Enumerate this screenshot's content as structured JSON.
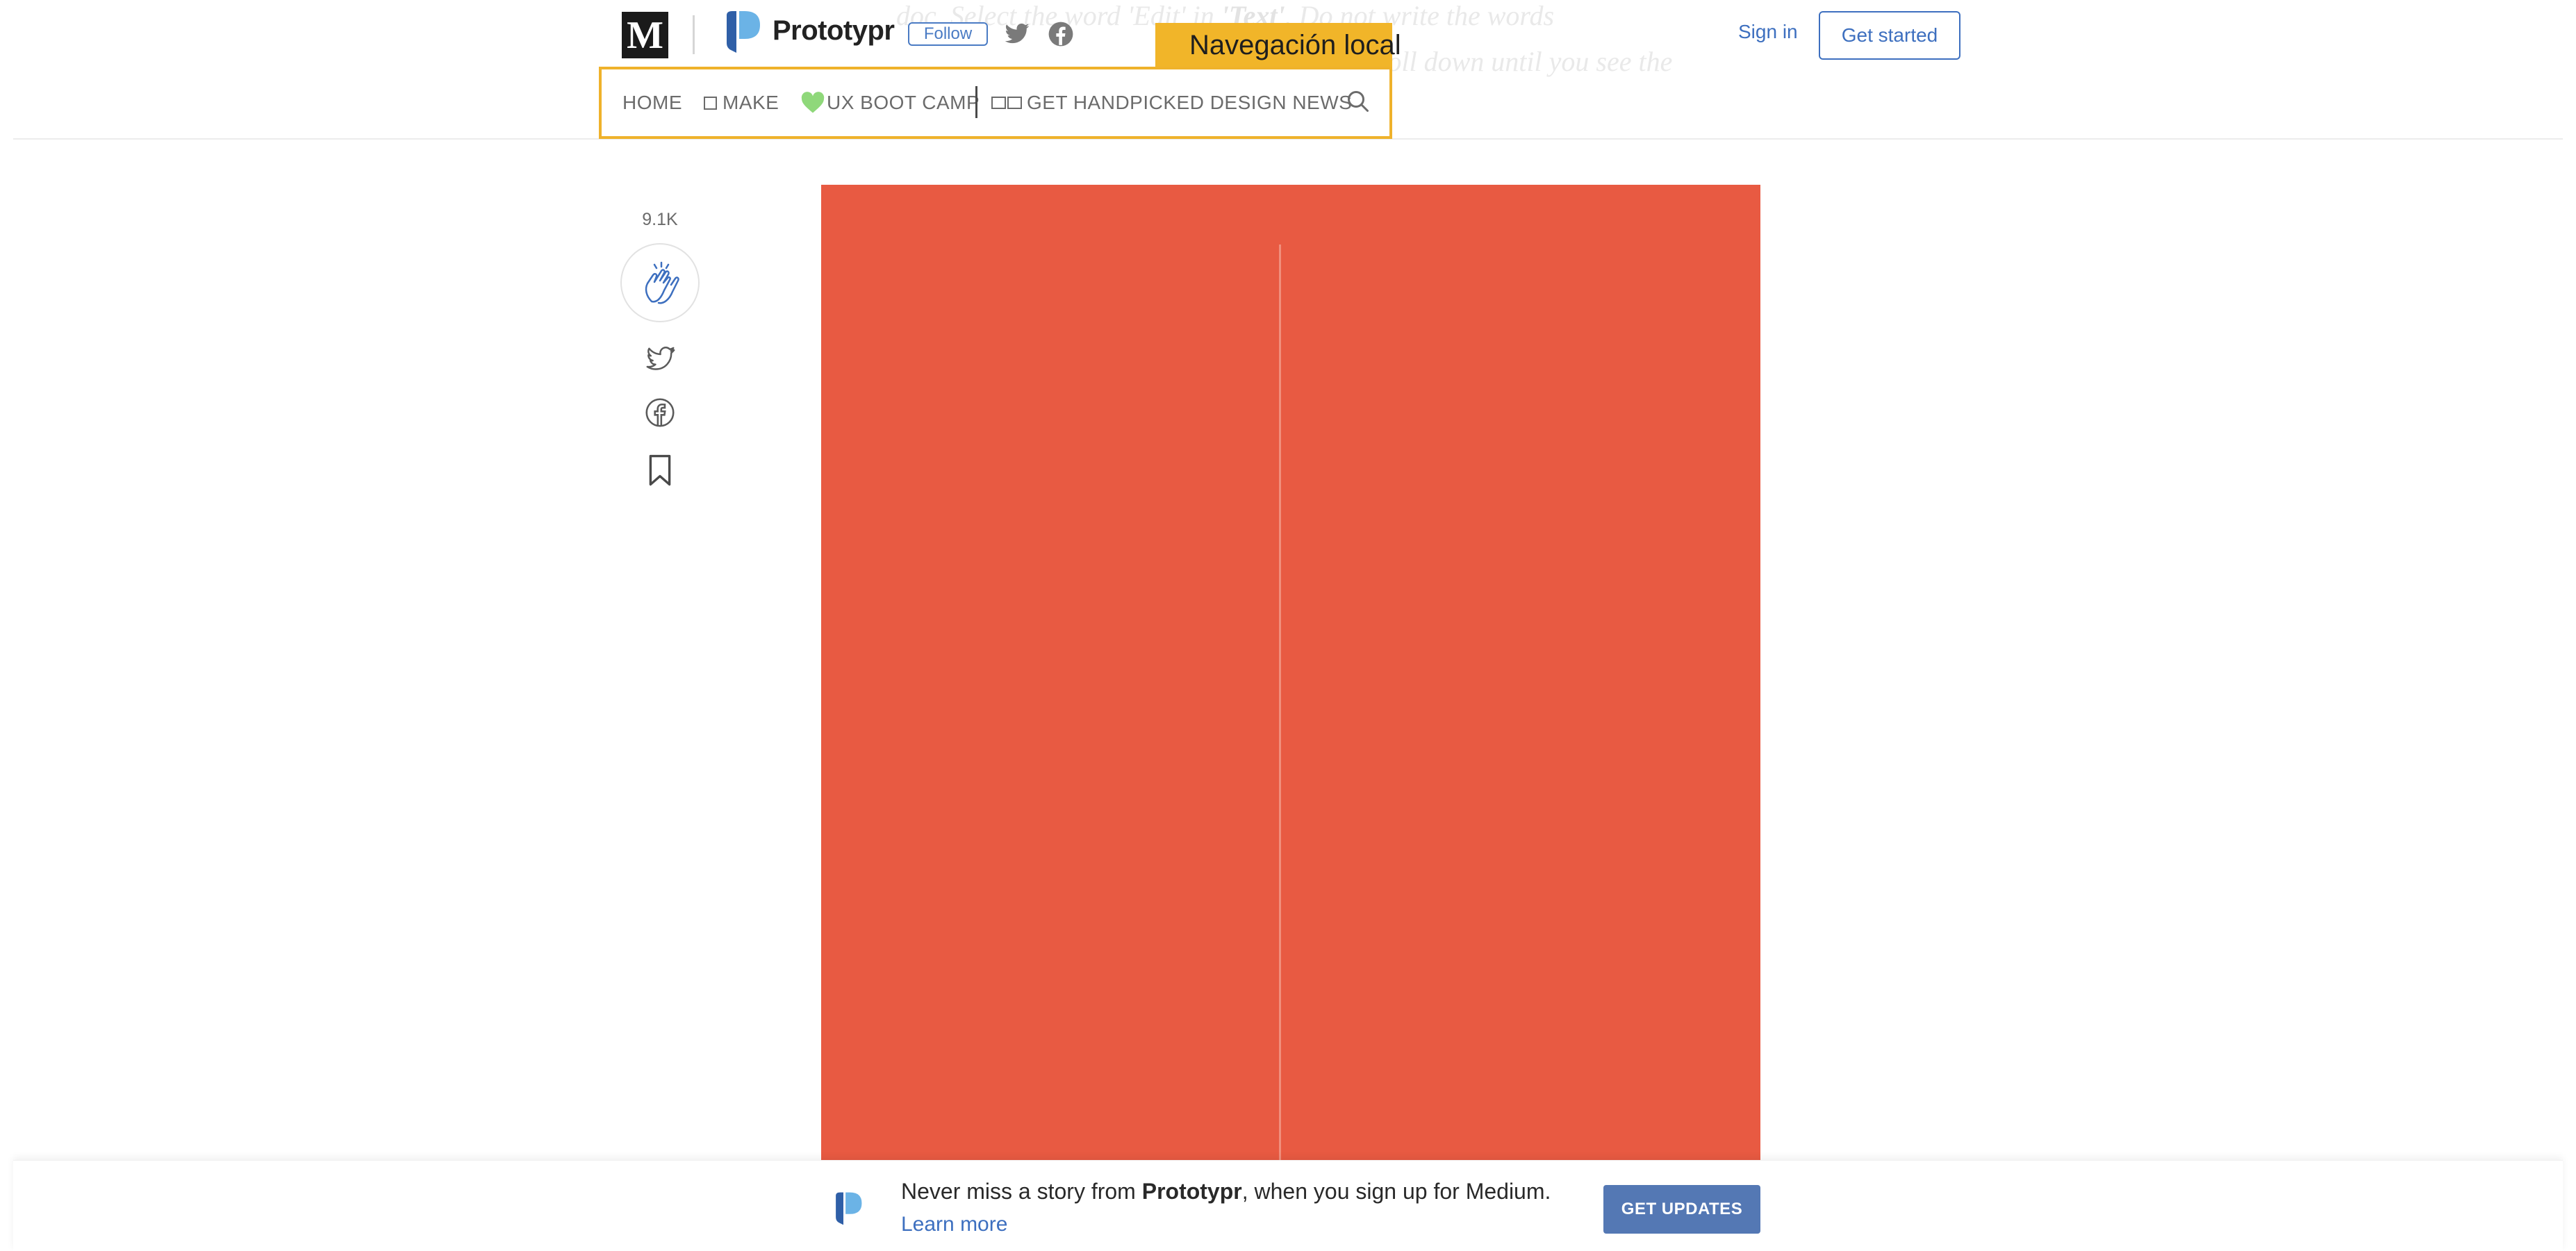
{
  "background_text": {
    "line1_prefix": "doc. Select the word 'Edit' in ",
    "line1_bold": "'Text'",
    "line1_suffix": ". Do not write the words",
    "line2": "and scroll down until you see the"
  },
  "header": {
    "logo_letter": "M",
    "publication_name": "Prototypr",
    "follow_label": "Follow",
    "sign_in_label": "Sign in",
    "get_started_label": "Get started"
  },
  "annotation": {
    "label": "Navegación local",
    "color": "#f1b529"
  },
  "local_nav": {
    "items": [
      {
        "label": "HOME"
      },
      {
        "label": "MAKE",
        "icon": "square-icon"
      },
      {
        "label": "UX BOOT CAMP",
        "icon": "green-heart-icon"
      },
      {
        "label": "GET HANDPICKED DESIGN NEWS",
        "icon": "open-book-icon"
      }
    ],
    "search_icon": "search-icon"
  },
  "actions": {
    "claps_count": "9.1K",
    "icons": [
      "clap-icon",
      "twitter-icon",
      "facebook-icon",
      "bookmark-icon"
    ]
  },
  "hero": {
    "color": "#e85a42"
  },
  "banner": {
    "text_prefix": "Never miss a story from ",
    "text_pub": "Prototypr",
    "text_suffix": ", when you sign up for Medium.",
    "learn_more_label": "Learn more",
    "cta_label": "GET UPDATES"
  },
  "colors": {
    "accent_blue": "#3d6fbf",
    "annotation_yellow": "#efb22b",
    "cta_blue": "#5478b4"
  }
}
